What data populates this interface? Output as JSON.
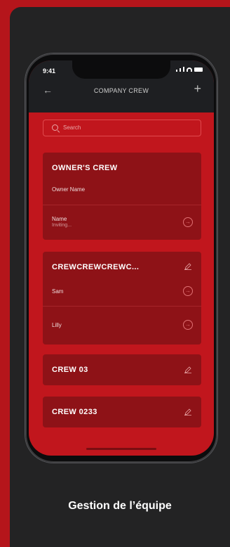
{
  "status_bar": {
    "time": "9:41"
  },
  "header": {
    "title": "COMPANY CREW",
    "back_icon": "arrow-left-icon",
    "add_icon": "plus-icon"
  },
  "search": {
    "placeholder": "Search"
  },
  "groups": [
    {
      "title": "OWNER'S CREW",
      "subtitle": "Owner Name",
      "members": [
        {
          "name": "Name",
          "status": "Inviting..."
        }
      ]
    },
    {
      "title": "CREWCREWCREWC...",
      "members": [
        {
          "name": "Sam"
        },
        {
          "name": "Lilly"
        }
      ]
    },
    {
      "title": "CREW 03"
    },
    {
      "title": "CREW 0233"
    }
  ],
  "caption": "Gestion de l’équipe",
  "colors": {
    "background": "#b5151b",
    "card": "#232324",
    "screen": "#c1161d",
    "group": "#8e1217",
    "topbar": "#1e1f22"
  }
}
